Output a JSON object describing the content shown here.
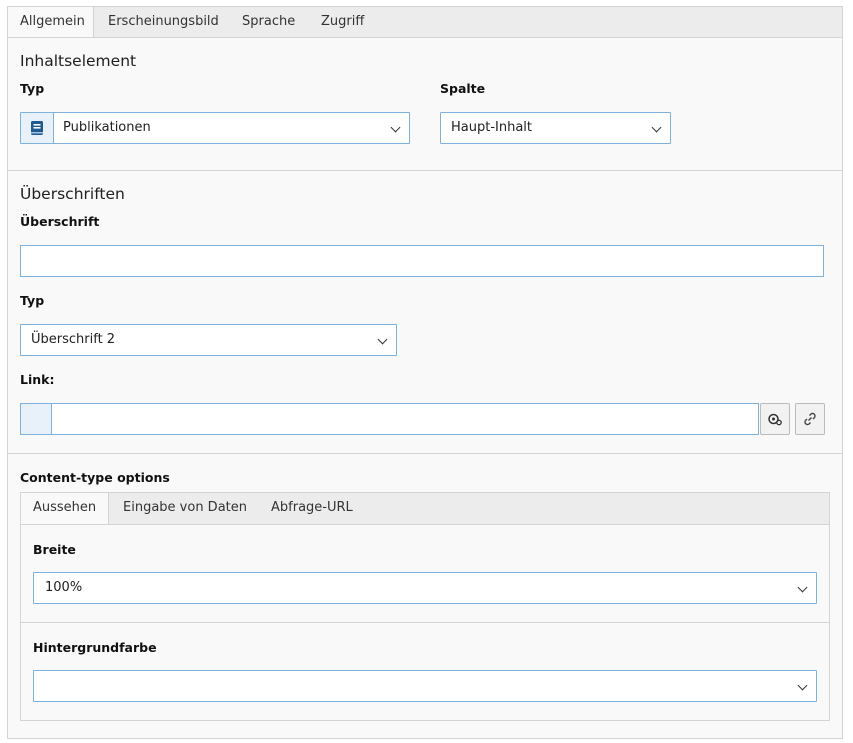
{
  "tabs": [
    {
      "label": "Allgemein",
      "active": true
    },
    {
      "label": "Erscheinungsbild",
      "active": false
    },
    {
      "label": "Sprache",
      "active": false
    },
    {
      "label": "Zugriff",
      "active": false
    }
  ],
  "inhaltselement": {
    "title": "Inhaltselement",
    "typ_label": "Typ",
    "typ_value": "Publikationen",
    "typ_icon": "book-icon",
    "spalte_label": "Spalte",
    "spalte_value": "Haupt-Inhalt"
  },
  "ueberschriften": {
    "title": "Überschriften",
    "ueberschrift_label": "Überschrift",
    "ueberschrift_value": "",
    "typ_label": "Typ",
    "typ_value": "Überschrift 2",
    "link_label": "Link:",
    "link_value": "",
    "link_buttons": [
      "link-options-icon",
      "link-browser-icon"
    ]
  },
  "content_type": {
    "title": "Content-type options",
    "subtabs": [
      {
        "label": "Aussehen",
        "active": true
      },
      {
        "label": "Eingabe von Daten",
        "active": false
      },
      {
        "label": "Abfrage-URL",
        "active": false
      }
    ],
    "breite_label": "Breite",
    "breite_value": "100%",
    "hintergrund_label": "Hintergrundfarbe",
    "hintergrund_value": ""
  },
  "colors": {
    "input_border": "#7fb1dd",
    "panel_bg": "#f9f9f9",
    "tab_bg": "#ececec",
    "icon_blue": "#1f5b8f"
  }
}
